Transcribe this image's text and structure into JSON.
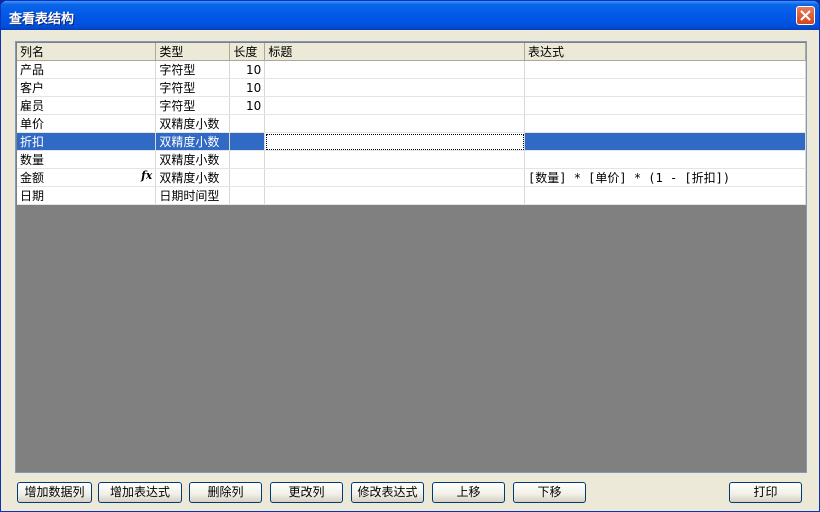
{
  "window": {
    "title": "查看表结构"
  },
  "grid": {
    "columns": [
      "列名",
      "类型",
      "长度",
      "标题",
      "表达式"
    ],
    "rows": [
      {
        "name": "产品",
        "type": "字符型",
        "length": "10",
        "caption": "",
        "expression": ""
      },
      {
        "name": "客户",
        "type": "字符型",
        "length": "10",
        "caption": "",
        "expression": ""
      },
      {
        "name": "雇员",
        "type": "字符型",
        "length": "10",
        "caption": "",
        "expression": ""
      },
      {
        "name": "单价",
        "type": "双精度小数",
        "length": "",
        "caption": "",
        "expression": ""
      },
      {
        "name": "折扣",
        "type": "双精度小数",
        "length": "",
        "caption": "",
        "expression": ""
      },
      {
        "name": "数量",
        "type": "双精度小数",
        "length": "",
        "caption": "",
        "expression": ""
      },
      {
        "name": "金额",
        "type": "双精度小数",
        "length": "",
        "caption": "",
        "expression": "[数量] * [单价] * (1 - [折扣])"
      },
      {
        "name": "日期",
        "type": "日期时间型",
        "length": "",
        "caption": "",
        "expression": ""
      }
    ],
    "fx_symbol": "fx"
  },
  "buttons": {
    "add_data_column": "增加数据列",
    "add_expression": "增加表达式",
    "delete_column": "删除列",
    "change_column": "更改列",
    "modify_expression": "修改表达式",
    "move_up": "上移",
    "move_down": "下移",
    "print": "打印"
  }
}
